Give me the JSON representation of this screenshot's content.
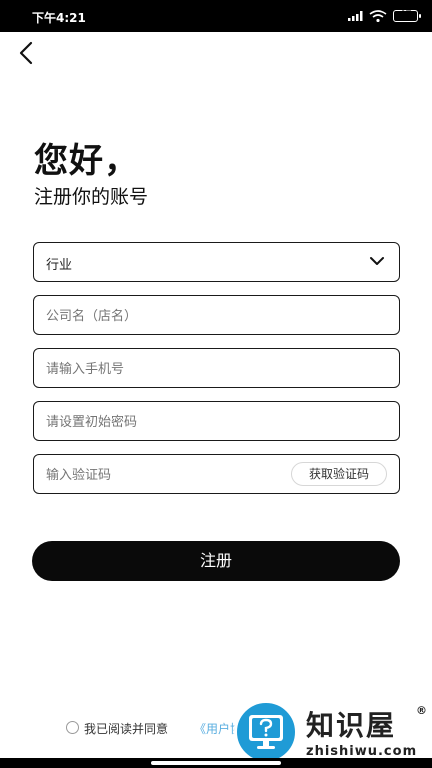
{
  "status_bar": {
    "time": "下午4:21",
    "battery": "47",
    "icons": [
      "signal-icon",
      "wifi-icon",
      "battery-icon"
    ]
  },
  "nav": {
    "back_icon": "chevron-left-icon"
  },
  "header": {
    "greeting": "您好，",
    "subtitle": "注册你的账号"
  },
  "form": {
    "industry": {
      "placeholder": "行业",
      "icon": "chevron-down-icon"
    },
    "company": {
      "placeholder": "公司名（店名）"
    },
    "phone": {
      "placeholder": "请输入手机号"
    },
    "password": {
      "placeholder": "请设置初始密码"
    },
    "code": {
      "placeholder": "输入验证码",
      "button_label": "获取验证码"
    },
    "submit_label": "注册"
  },
  "agreement": {
    "text": "我已阅读并同意",
    "link": "《用户协"
  },
  "watermark": {
    "title": "知识屋",
    "reg": "®",
    "url": "zhishiwu.com"
  },
  "colors": {
    "primary_button": "#0a0a0a",
    "link": "#5aaee0",
    "badge": "#1f9bd6"
  }
}
